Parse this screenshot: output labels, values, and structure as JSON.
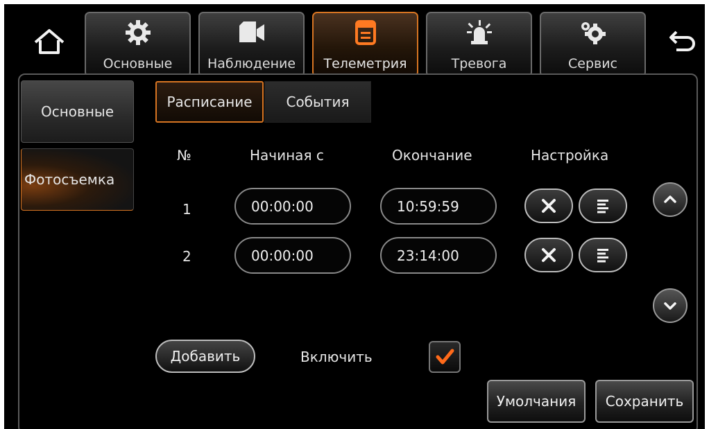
{
  "colors": {
    "accent": "#d87522",
    "check": "#ff6a1a",
    "background": "#000000"
  },
  "nav": {
    "home_icon": "home-icon",
    "back_icon": "back-arrow-icon",
    "tabs": [
      {
        "label": "Основные",
        "icon": "gear-icon"
      },
      {
        "label": "Наблюдение",
        "icon": "video-camera-icon"
      },
      {
        "label": "Телеметрия",
        "icon": "telemetry-icon",
        "active": true
      },
      {
        "label": "Тревога",
        "icon": "alarm-light-icon"
      },
      {
        "label": "Сервис",
        "icon": "service-gears-icon"
      }
    ]
  },
  "sidebar": {
    "items": [
      {
        "label": "Основные"
      },
      {
        "label": "Фотосъемка",
        "active": true
      }
    ]
  },
  "subtabs": [
    {
      "label": "Расписание",
      "active": true
    },
    {
      "label": "События"
    }
  ],
  "table": {
    "headers": [
      "№",
      "Начиная с",
      "Окончание",
      "Настройка"
    ],
    "rows": [
      {
        "num": "1",
        "start": "00:00:00",
        "end": "10:59:59"
      },
      {
        "num": "2",
        "start": "00:00:00",
        "end": "23:14:00"
      }
    ]
  },
  "controls": {
    "add_label": "Добавить",
    "enable_label": "Включить",
    "enable_checked": true,
    "default_label": "Умолчания",
    "save_label": "Сохранить"
  }
}
